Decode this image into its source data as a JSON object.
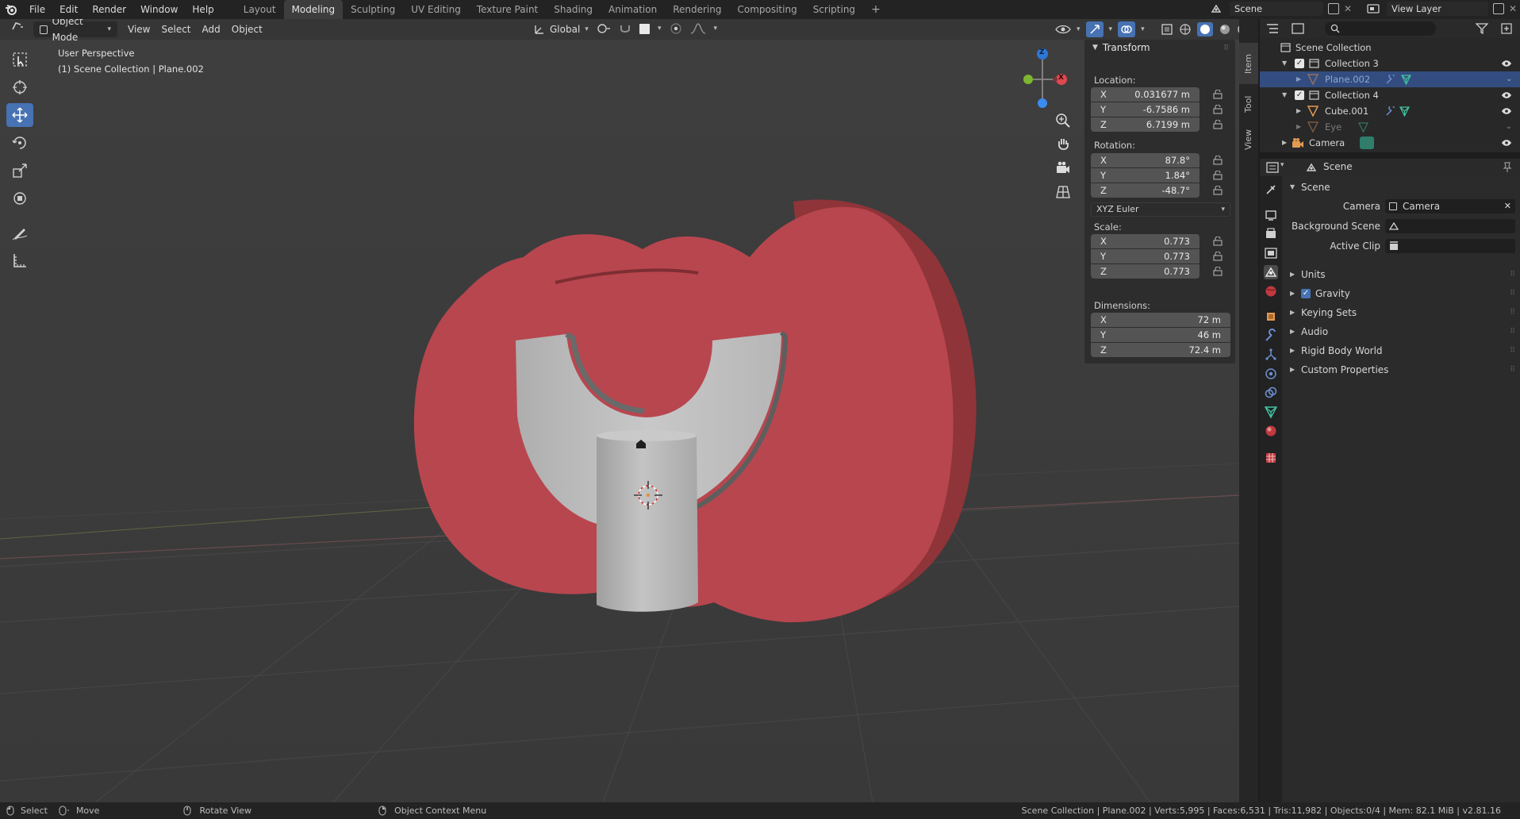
{
  "menubar": {
    "items": [
      "File",
      "Edit",
      "Render",
      "Window",
      "Help"
    ],
    "workspaces": [
      "Layout",
      "Modeling",
      "Sculpting",
      "UV Editing",
      "Texture Paint",
      "Shading",
      "Animation",
      "Rendering",
      "Compositing",
      "Scripting"
    ],
    "active_workspace": "Modeling",
    "add_tab": "+",
    "scene_name": "Scene",
    "view_layer": "View Layer"
  },
  "viewport_header": {
    "mode": "Object Mode",
    "menus": [
      "View",
      "Select",
      "Add",
      "Object"
    ],
    "orientation": "Global"
  },
  "viewport": {
    "view_name": "User Perspective",
    "context": "(1) Scene Collection | Plane.002",
    "gizmo": {
      "x": "X",
      "y": "Y",
      "z": "Z"
    },
    "tools": [
      "select-box",
      "cursor",
      "move",
      "rotate",
      "scale",
      "transform",
      "annotate",
      "measure"
    ],
    "active_tool": "move",
    "colors": {
      "background": "#3f3f3f",
      "red_object": "#b8464e",
      "gray_object": "#bcbcbc",
      "grid": "#474747"
    }
  },
  "npanel": {
    "title": "Transform",
    "location_label": "Location:",
    "location": {
      "x": "0.031677 m",
      "y": "-6.7586 m",
      "z": "6.7199 m"
    },
    "rotation_label": "Rotation:",
    "rotation": {
      "x": "87.8°",
      "y": "1.84°",
      "z": "-48.7°"
    },
    "rotation_mode": "XYZ Euler",
    "scale_label": "Scale:",
    "scale": {
      "x": "0.773",
      "y": "0.773",
      "z": "0.773"
    },
    "dimensions_label": "Dimensions:",
    "dimensions": {
      "x": "72 m",
      "y": "46 m",
      "z": "72.4 m"
    },
    "axis_labels": {
      "x": "X",
      "y": "Y",
      "z": "Z"
    },
    "side_tabs": [
      "Item",
      "Tool",
      "View"
    ]
  },
  "outliner": {
    "root": "Scene Collection",
    "rows": [
      {
        "name": "Collection 3"
      },
      {
        "name": "Plane.002"
      },
      {
        "name": "Collection 4"
      },
      {
        "name": "Cube.001"
      },
      {
        "name": "Eye"
      },
      {
        "name": "Camera"
      }
    ]
  },
  "properties": {
    "header": "Scene",
    "section": "Scene",
    "camera_label": "Camera",
    "camera_value": "Camera",
    "background_scene_label": "Background Scene",
    "active_clip_label": "Active Clip",
    "panels": [
      "Units",
      "Gravity",
      "Keying Sets",
      "Audio",
      "Rigid Body World",
      "Custom Properties"
    ]
  },
  "statusbar": {
    "select": "Select",
    "move": "Move",
    "rotate_view": "Rotate View",
    "context_menu": "Object Context Menu",
    "stats": "Scene Collection | Plane.002 | Verts:5,995 | Faces:6,531 | Tris:11,982 | Objects:0/4 | Mem: 82.1 MiB | v2.81.16"
  }
}
